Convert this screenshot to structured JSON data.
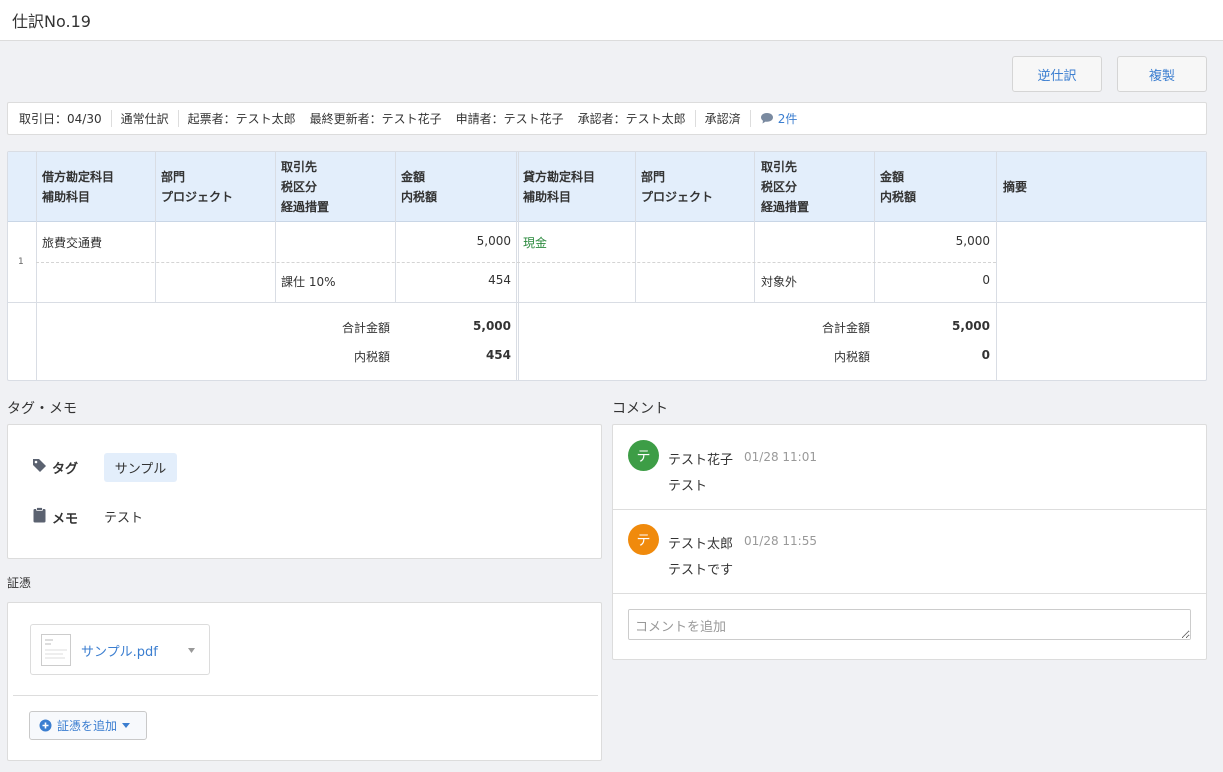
{
  "header": {
    "title": "仕訳No.19"
  },
  "actions": {
    "reverse_label": "逆仕訳",
    "copy_label": "複製"
  },
  "info": {
    "date": "取引日：04/30",
    "type": "通常仕訳",
    "creator": "起票者：テスト太郎",
    "updater": "最終更新者：テスト花子",
    "applicant": "申請者：テスト花子",
    "approver": "承認者：テスト太郎",
    "status": "承認済",
    "comment_count": "2件"
  },
  "table": {
    "headers": {
      "debit_account": [
        "借方勘定科目",
        "補助科目"
      ],
      "debit_dept": [
        "部門",
        "プロジェクト"
      ],
      "debit_partner": [
        "取引先",
        "税区分",
        "経過措置"
      ],
      "debit_amount": [
        "金額",
        "内税額"
      ],
      "credit_account": [
        "貸方勘定科目",
        "補助科目"
      ],
      "credit_dept": [
        "部門",
        "プロジェクト"
      ],
      "credit_partner": [
        "取引先",
        "税区分",
        "経過措置"
      ],
      "credit_amount": [
        "金額",
        "内税額"
      ],
      "memo": "摘要"
    },
    "row": {
      "no": "1",
      "debit_account": "旅費交通費",
      "debit_amount": "5,000",
      "debit_tax_category": "課仕 10%",
      "debit_tax": "454",
      "credit_account": "現金",
      "credit_amount": "5,000",
      "credit_tax_category": "対象外",
      "credit_tax": "0"
    },
    "totals": {
      "total_label": "合計金額",
      "tax_label": "内税額",
      "debit_total": "5,000",
      "debit_tax": "454",
      "credit_total": "5,000",
      "credit_tax": "0"
    }
  },
  "tags_memo": {
    "section_title": "タグ・メモ",
    "tag_label": "タグ",
    "tag_value": "サンプル",
    "memo_label": "メモ",
    "memo_value": "テスト"
  },
  "evidence": {
    "section_title": "証憑",
    "file_name": "サンプル.pdf",
    "add_label": "証憑を追加"
  },
  "comments": {
    "section_title": "コメント",
    "items": [
      {
        "initial": "テ",
        "author": "テスト花子",
        "time": "01/28 11:01",
        "text": "テスト",
        "color": "#3d9d46"
      },
      {
        "initial": "テ",
        "author": "テスト太郎",
        "time": "01/28 11:55",
        "text": "テストです",
        "color": "#f08a0c"
      }
    ],
    "placeholder": "コメントを追加"
  },
  "colors": {
    "accent": "#3b7ed0",
    "header_bg": "#e3eefb",
    "credit_account": "#2b8a3e"
  }
}
